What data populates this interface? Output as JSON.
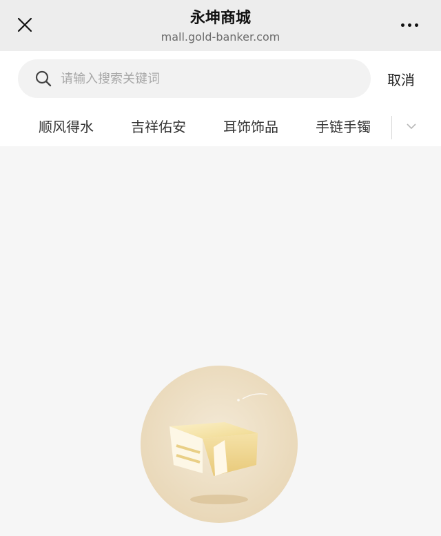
{
  "titlebar": {
    "title": "永坤商城",
    "subtitle": "mall.gold-banker.com",
    "close_icon": "close-icon",
    "more_icon": "more-icon"
  },
  "search": {
    "placeholder": "请输入搜索关键词",
    "value": "",
    "cancel_label": "取消",
    "icon": "search-icon"
  },
  "categories": {
    "items": [
      {
        "label": "顺风得水"
      },
      {
        "label": "吉祥佑安"
      },
      {
        "label": "耳饰饰品"
      },
      {
        "label": "手链手镯"
      }
    ],
    "expand_icon": "chevron-down-icon"
  },
  "empty_state": {
    "illustration": "empty-box-icon"
  },
  "colors": {
    "titlebar_bg": "#ededed",
    "page_bg": "#f6f6f6",
    "illustration_circle": "#efe3cc",
    "illustration_box": "#f3dd9a"
  }
}
